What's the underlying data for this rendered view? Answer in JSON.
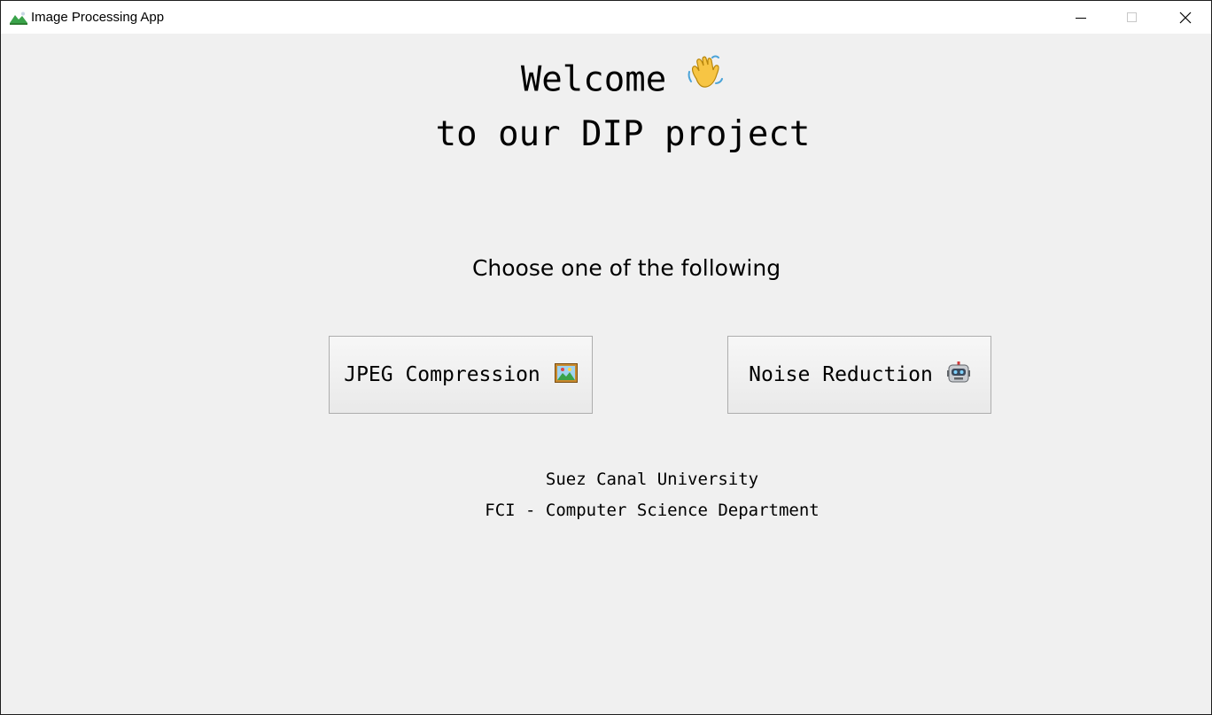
{
  "window": {
    "title": "Image Processing App",
    "icon": "landscape-icon",
    "controls": [
      "minimize-icon",
      "maximize-icon",
      "close-icon"
    ]
  },
  "welcome": {
    "line1": "Welcome",
    "line1_emoji": "waving-hand-icon",
    "line2": "to our DIP project"
  },
  "prompt": "Choose one of the following",
  "buttons": {
    "jpeg": {
      "label": "JPEG Compression",
      "icon": "framed-picture-icon"
    },
    "noise": {
      "label": "Noise Reduction",
      "icon": "robot-icon"
    }
  },
  "footer": {
    "line1": "Suez Canal University",
    "line2": "FCI - Computer Science Department"
  }
}
